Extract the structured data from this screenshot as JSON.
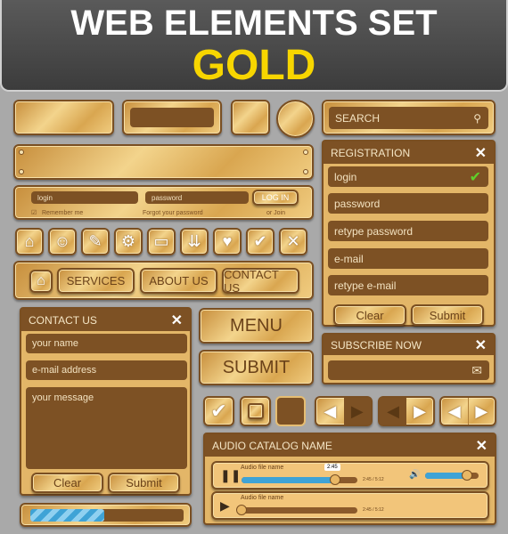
{
  "header": {
    "title": "WEB ELEMENTS SET",
    "subtitle": "GOLD"
  },
  "search": {
    "placeholder": "SEARCH",
    "icon": "search-icon"
  },
  "login_bar": {
    "login": "login",
    "password": "password",
    "button": "LOG IN",
    "remember": "Remember me",
    "forgot": "Forgot your password",
    "join": "or Join"
  },
  "icons": [
    "home-icon",
    "user-icon",
    "pencil-icon",
    "gear-icon",
    "chat-icon",
    "double-chevron-down-icon",
    "heart-icon",
    "check-icon",
    "close-icon"
  ],
  "nav": {
    "items": [
      "SERVICES",
      "ABOUT US",
      "CONTACT US"
    ]
  },
  "registration": {
    "title": "REGISTRATION",
    "fields": [
      "login",
      "password",
      "retype password",
      "e-mail",
      "retype e-mail"
    ],
    "clear": "Clear",
    "submit": "Submit"
  },
  "contact": {
    "title": "CONTACT US",
    "fields": [
      "your name",
      "e-mail address",
      "your message"
    ],
    "clear": "Clear",
    "submit": "Submit"
  },
  "buttons": {
    "menu": "MENU",
    "submit": "SUBMIT"
  },
  "subscribe": {
    "title": "SUBSCRIBE NOW"
  },
  "checkboxes": [
    true,
    false,
    false
  ],
  "audio": {
    "title": "AUDIO CATALOG NAME",
    "tracks": [
      {
        "name": "Audio file name",
        "time": "2:45 / 5:12",
        "progress": 0.81,
        "tooltip": "2:45",
        "playing": true,
        "volume": 0.78
      },
      {
        "name": "Audio file name",
        "time": "2:45 / 5:12",
        "progress": 0.0,
        "playing": false
      }
    ]
  },
  "progress": {
    "value": 0.48
  },
  "colors": {
    "gold": "#e3b668",
    "brown": "#7d5124",
    "accent_blue": "#3fa3d6",
    "title_yellow": "#f7d600"
  }
}
